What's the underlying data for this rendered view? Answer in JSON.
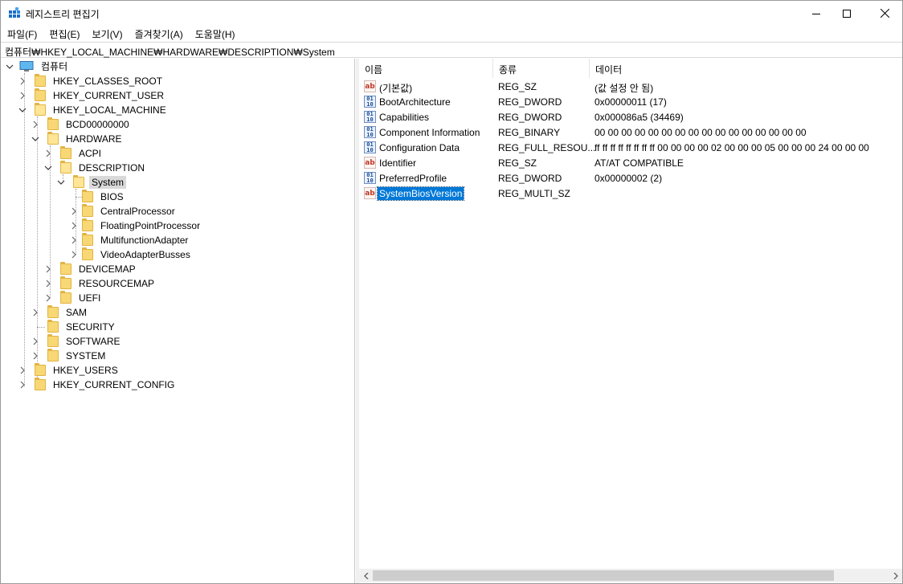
{
  "window": {
    "title": "레지스트리 편집기",
    "icon": "registry-editor-icon",
    "controls": [
      "minimize-icon",
      "maximize-icon",
      "close-icon"
    ]
  },
  "menu": [
    "파일(F)",
    "편집(E)",
    "보기(V)",
    "즐겨찾기(A)",
    "도움말(H)"
  ],
  "address": "컴퓨터₩HKEY_LOCAL_MACHINE₩HARDWARE₩DESCRIPTION₩System",
  "tree": {
    "root": "컴퓨터",
    "hkcr": "HKEY_CLASSES_ROOT",
    "hkcu": "HKEY_CURRENT_USER",
    "hklm": "HKEY_LOCAL_MACHINE",
    "bcd": "BCD00000000",
    "hardware": "HARDWARE",
    "acpi": "ACPI",
    "description": "DESCRIPTION",
    "system": "System",
    "bios": "BIOS",
    "central": "CentralProcessor",
    "floating": "FloatingPointProcessor",
    "multifunction": "MultifunctionAdapter",
    "video": "VideoAdapterBusses",
    "devicemap": "DEVICEMAP",
    "resourcemap": "RESOURCEMAP",
    "uefi": "UEFI",
    "sam": "SAM",
    "security": "SECURITY",
    "software": "SOFTWARE",
    "system_hive": "SYSTEM",
    "hku": "HKEY_USERS",
    "hkcc": "HKEY_CURRENT_CONFIG"
  },
  "list": {
    "headers": {
      "name": "이름",
      "type": "종류",
      "data": "데이터"
    },
    "rows": [
      {
        "icon": "string-value-icon",
        "name": "(기본값)",
        "type": "REG_SZ",
        "data": "(값 설정 안 됨)"
      },
      {
        "icon": "binary-value-icon",
        "name": "BootArchitecture",
        "type": "REG_DWORD",
        "data": "0x00000011 (17)"
      },
      {
        "icon": "binary-value-icon",
        "name": "Capabilities",
        "type": "REG_DWORD",
        "data": "0x000086a5 (34469)"
      },
      {
        "icon": "binary-value-icon",
        "name": "Component Information",
        "type": "REG_BINARY",
        "data": "00 00 00 00 00 00 00 00 00 00 00 00 00 00 00 00"
      },
      {
        "icon": "binary-value-icon",
        "name": "Configuration Data",
        "type": "REG_FULL_RESOU...",
        "data": "ff ff ff ff ff ff ff ff 00 00 00 00 02 00 00 00 05 00 00 00 24 00 00 00"
      },
      {
        "icon": "string-value-icon",
        "name": "Identifier",
        "type": "REG_SZ",
        "data": "AT/AT COMPATIBLE"
      },
      {
        "icon": "binary-value-icon",
        "name": "PreferredProfile",
        "type": "REG_DWORD",
        "data": "0x00000002 (2)"
      },
      {
        "icon": "string-value-icon",
        "name": "SystemBiosVersion",
        "type": "REG_MULTI_SZ",
        "data": ""
      }
    ]
  },
  "colors": {
    "selection": "#0078d7",
    "tree_selection": "#d9d9d9",
    "folder": "#f8d775"
  }
}
